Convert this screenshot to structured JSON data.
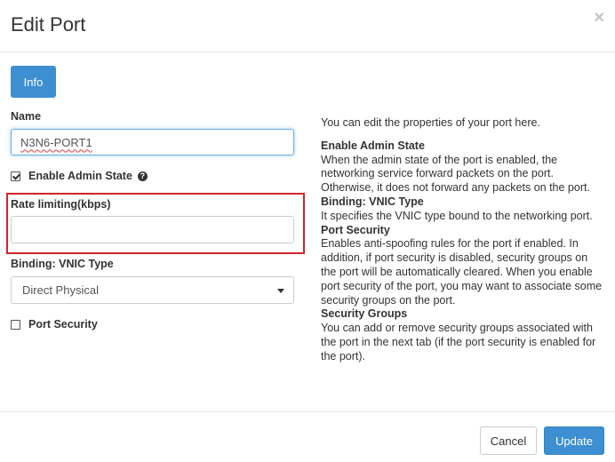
{
  "header": {
    "title": "Edit Port",
    "close_label": "×"
  },
  "tabs": [
    {
      "label": "Info"
    }
  ],
  "form": {
    "name_label": "Name",
    "name_value": "N3N6-PORT1",
    "admin_state_label": "Enable Admin State",
    "admin_state_checked": true,
    "rate_limit_label": "Rate limiting(kbps)",
    "rate_limit_value": "",
    "vnic_label": "Binding: VNIC Type",
    "vnic_selected": "Direct Physical",
    "port_security_label": "Port Security",
    "port_security_checked": false
  },
  "help": {
    "intro": "You can edit the properties of your port here.",
    "sections": [
      {
        "heading": "Enable Admin State",
        "text": "When the admin state of the port is enabled, the networking service forward packets on the port. Otherwise, it does not forward any packets on the port."
      },
      {
        "heading": "Binding: VNIC Type",
        "text": "It specifies the VNIC type bound to the networking port."
      },
      {
        "heading": "Port Security",
        "text": "Enables anti-spoofing rules for the port if enabled. In addition, if port security is disabled, security groups on the port will be automatically cleared. When you enable port security of the port, you may want to associate some security groups on the port."
      },
      {
        "heading": "Security Groups",
        "text": "You can add or remove security groups associated with the port in the next tab (if the port security is enabled for the port)."
      }
    ]
  },
  "footer": {
    "cancel_label": "Cancel",
    "update_label": "Update"
  },
  "colors": {
    "primary": "#3d8fd1",
    "highlight": "#d0252b",
    "focus": "#66afe9"
  }
}
